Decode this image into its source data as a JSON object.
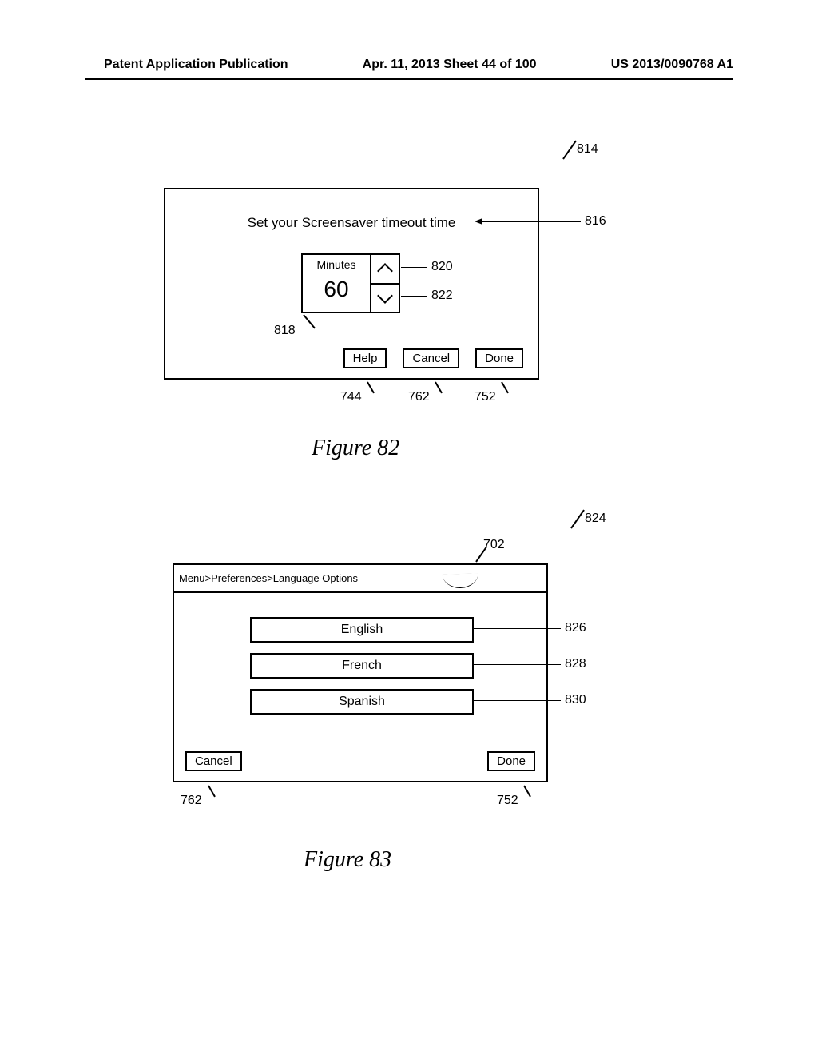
{
  "header": {
    "left": "Patent Application Publication",
    "center": "Apr. 11, 2013  Sheet 44 of 100",
    "right": "US 2013/0090768 A1"
  },
  "fig82": {
    "ref_panel": "814",
    "title": "Set your Screensaver timeout time",
    "ref_title": "816",
    "spinner": {
      "label": "Minutes",
      "value": "60",
      "ref_value": "818",
      "ref_up": "820",
      "ref_down": "822"
    },
    "buttons": {
      "help": {
        "label": "Help",
        "ref": "744"
      },
      "cancel": {
        "label": "Cancel",
        "ref": "762"
      },
      "done": {
        "label": "Done",
        "ref": "752"
      }
    },
    "caption": "Figure 82"
  },
  "fig83": {
    "ref_panel": "824",
    "breadcrumb": "Menu>Preferences>Language Options",
    "ref_breadcrumb": "702",
    "languages": [
      {
        "label": "English",
        "ref": "826"
      },
      {
        "label": "French",
        "ref": "828"
      },
      {
        "label": "Spanish",
        "ref": "830"
      }
    ],
    "buttons": {
      "cancel": {
        "label": "Cancel",
        "ref": "762"
      },
      "done": {
        "label": "Done",
        "ref": "752"
      }
    },
    "caption": "Figure 83"
  }
}
